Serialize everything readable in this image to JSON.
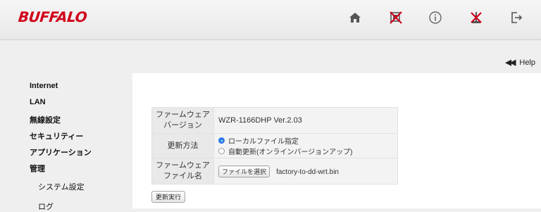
{
  "brand": {
    "logo_text": "BUFFALO",
    "logo_color": "#d0021b"
  },
  "toolbar": {
    "icons": [
      "home-icon",
      "network-disconnected-icon",
      "info-icon",
      "antenna-disconnected-icon",
      "logout-icon"
    ]
  },
  "help": {
    "label": "Help",
    "arrow": "◀◀"
  },
  "sidebar": {
    "items": [
      {
        "label": "Internet"
      },
      {
        "label": "LAN"
      },
      {
        "label": "無線設定"
      },
      {
        "label": "セキュリティー"
      },
      {
        "label": "アプリケーション"
      },
      {
        "label": "管理"
      }
    ],
    "subitems": [
      {
        "label": "システム設定"
      },
      {
        "label": "ログ"
      }
    ]
  },
  "firmware": {
    "version_label_line1": "ファームウェア",
    "version_label_line2": "バージョン",
    "version_value": "WZR-1166DHP Ver.2.03",
    "method_label": "更新方法",
    "method_options": [
      {
        "label": "ローカルファイル指定",
        "selected": true
      },
      {
        "label": "自動更新(オンラインバージョンアップ)",
        "selected": false
      }
    ],
    "file_label_line1": "ファームウェア",
    "file_label_line2": "ファイル名",
    "file_button": "ファイルを選択",
    "file_name": "factory-to-dd-wrt.bin",
    "apply_button": "更新実行"
  },
  "colors": {
    "accent_blue": "#2a7be4",
    "disconnect_red": "#d0021b"
  }
}
